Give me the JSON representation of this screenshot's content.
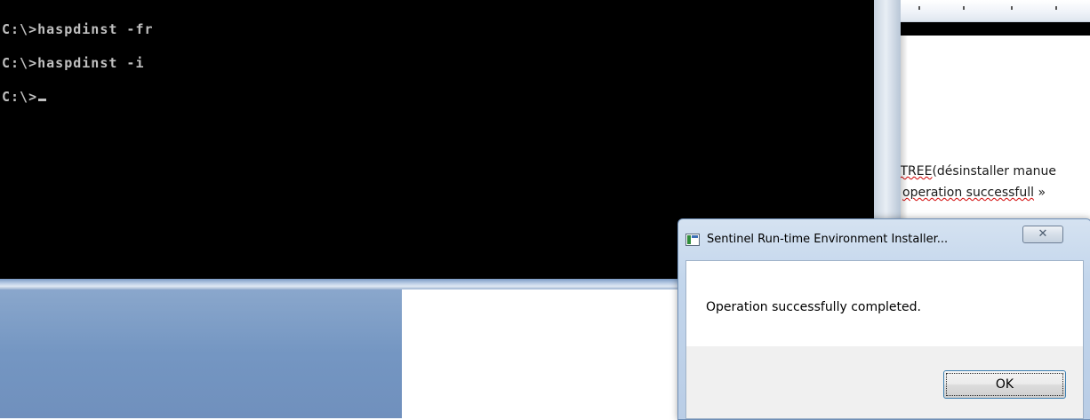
{
  "console": {
    "lines": [
      "C:\\>haspdinst -fr",
      "C:\\>haspdinst -i",
      "C:\\>"
    ]
  },
  "document": {
    "line1_underlined": "NTREE",
    "line1_rest": "(désinstaller manue",
    "line2_underlined": "operation successfull",
    "line2_rest": " »"
  },
  "dialog": {
    "title": "Sentinel Run-time Environment Installer...",
    "close_glyph": "✕",
    "message": "Operation successfully completed.",
    "ok_label": "OK"
  }
}
